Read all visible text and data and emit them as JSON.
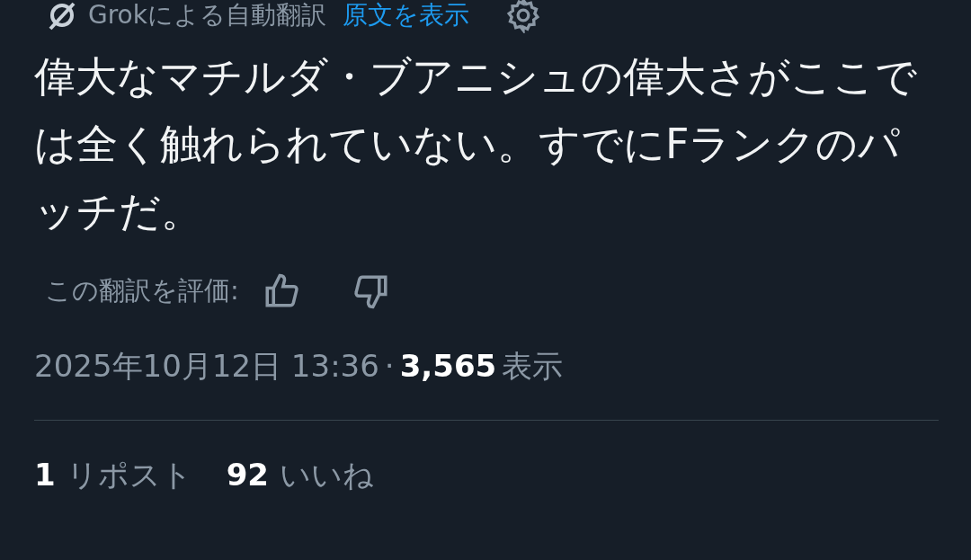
{
  "translation_bar": {
    "label": "Grokによる自動翻訳",
    "show_original": "原文を表示"
  },
  "post_text": "偉大なマチルダ・ブアニシュの偉大さがここでは全く触れられていない。すでにFランクのパッチだ。",
  "rating": {
    "label": "この翻訳を評価:"
  },
  "meta": {
    "timestamp": "2025年10月12日 13:36",
    "separator": "·",
    "views_count": "3,565",
    "views_label": "表示"
  },
  "stats": [
    {
      "count": "1",
      "label": "リポスト"
    },
    {
      "count": "92",
      "label": "いいね"
    }
  ]
}
